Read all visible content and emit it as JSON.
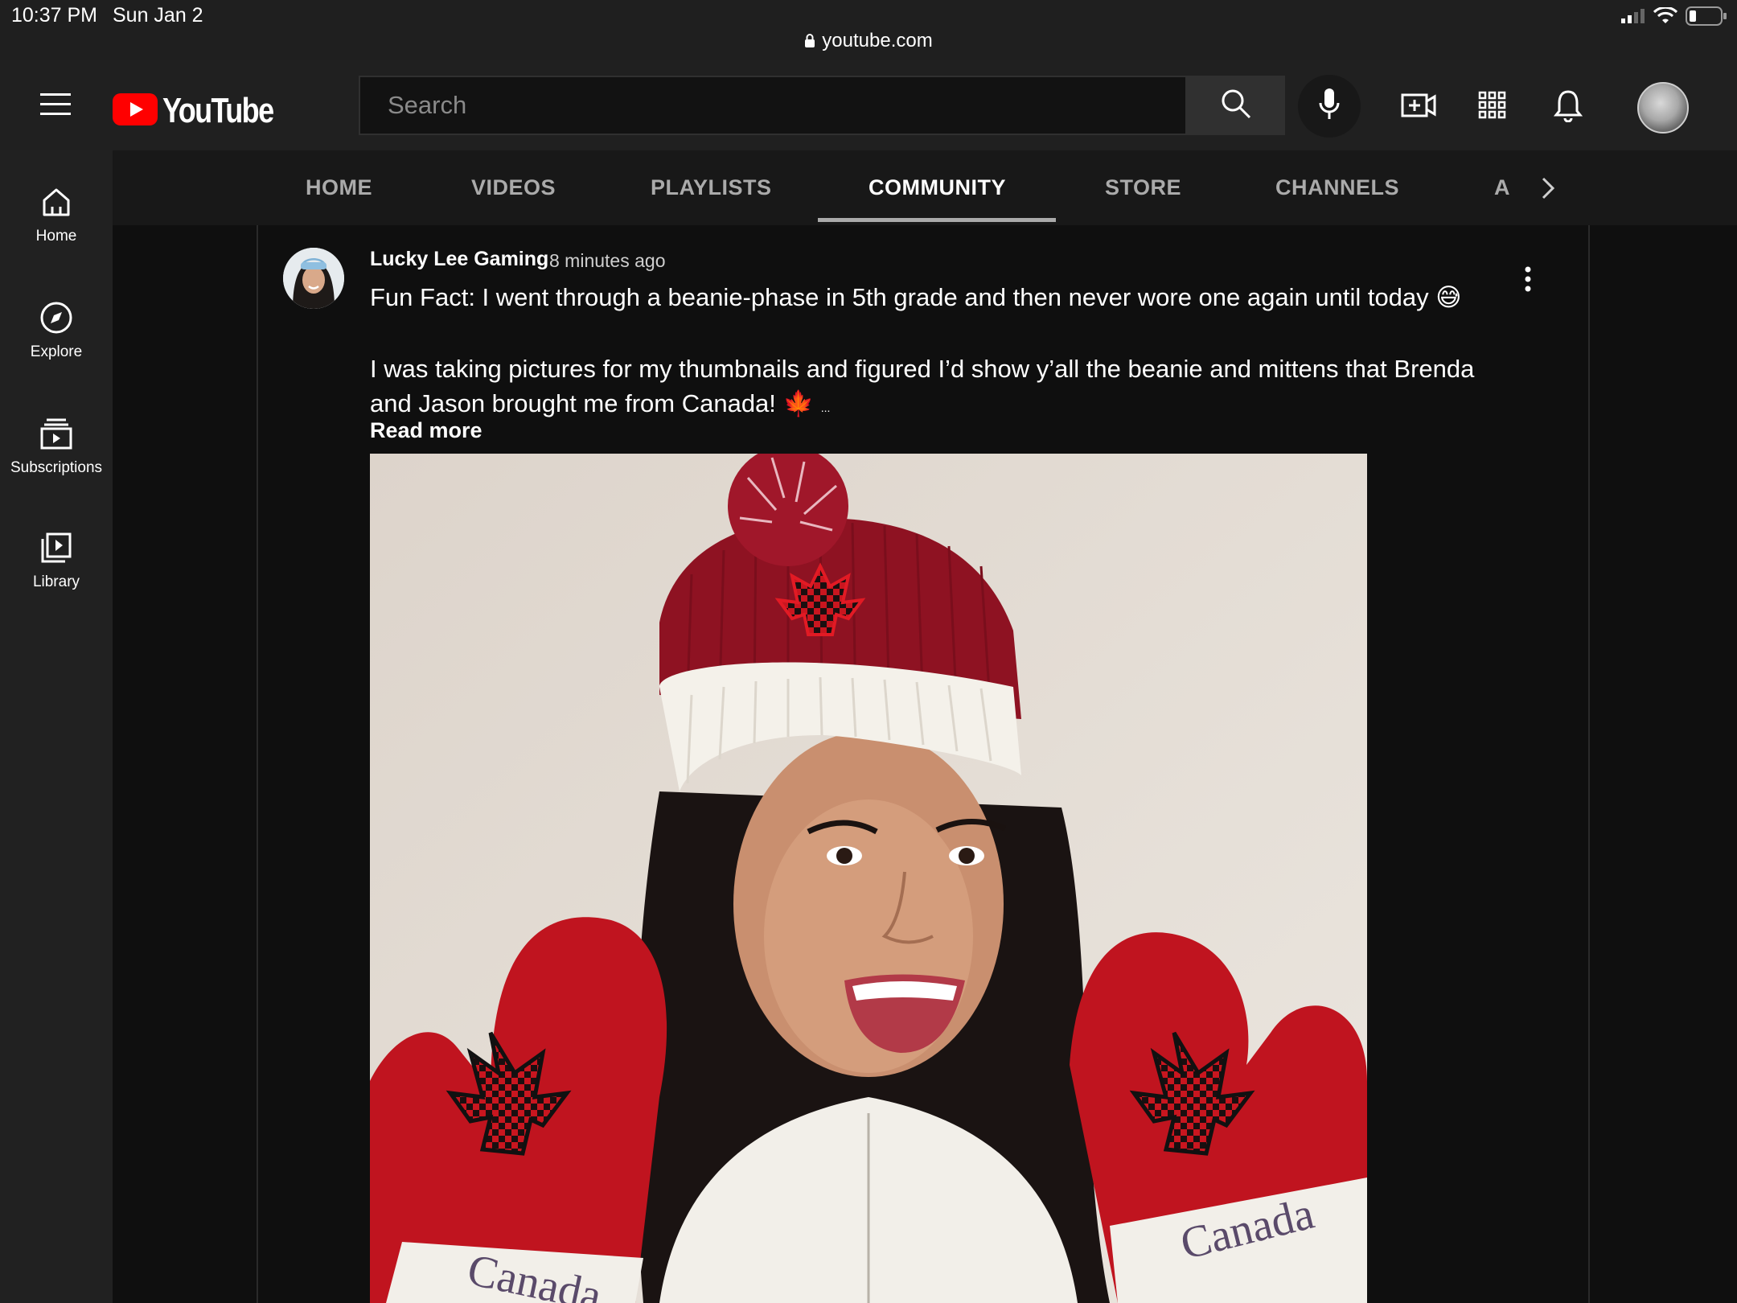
{
  "status_bar": {
    "time": "10:37 PM",
    "date": "Sun Jan 2",
    "url": "youtube.com",
    "icons": [
      "signal-icon",
      "wifi-icon",
      "battery-icon"
    ]
  },
  "header": {
    "logo_text": "YouTube",
    "search_placeholder": "Search",
    "icons": [
      "menu-icon",
      "search-icon",
      "mic-icon",
      "create-video-icon",
      "apps-icon",
      "bell-icon",
      "avatar"
    ]
  },
  "sidebar": {
    "items": [
      {
        "label": "Home",
        "icon": "home-icon"
      },
      {
        "label": "Explore",
        "icon": "compass-icon"
      },
      {
        "label": "Subscriptions",
        "icon": "subscriptions-icon"
      },
      {
        "label": "Library",
        "icon": "library-icon"
      }
    ]
  },
  "tabs": {
    "items": [
      "HOME",
      "VIDEOS",
      "PLAYLISTS",
      "COMMUNITY",
      "STORE",
      "CHANNELS",
      "A"
    ],
    "active": "COMMUNITY"
  },
  "post": {
    "author": "Lucky Lee Gaming",
    "time": "8 minutes ago",
    "line1": "Fun Fact: I went through a beanie-phase in 5th grade and then never wore one again until today 😅",
    "line2": "I was taking pictures for my thumbnails and figured I’d show y’all the beanie and mittens that Brenda and Jason brought me from Canada! 🍁",
    "ellipsis": "...",
    "read_more": "Read more",
    "mitten_text": "Canada"
  },
  "colors": {
    "brand_red": "#ff0000",
    "background": "#0f0f0f",
    "header_bg": "#202020",
    "sidebar_bg": "#212121"
  }
}
